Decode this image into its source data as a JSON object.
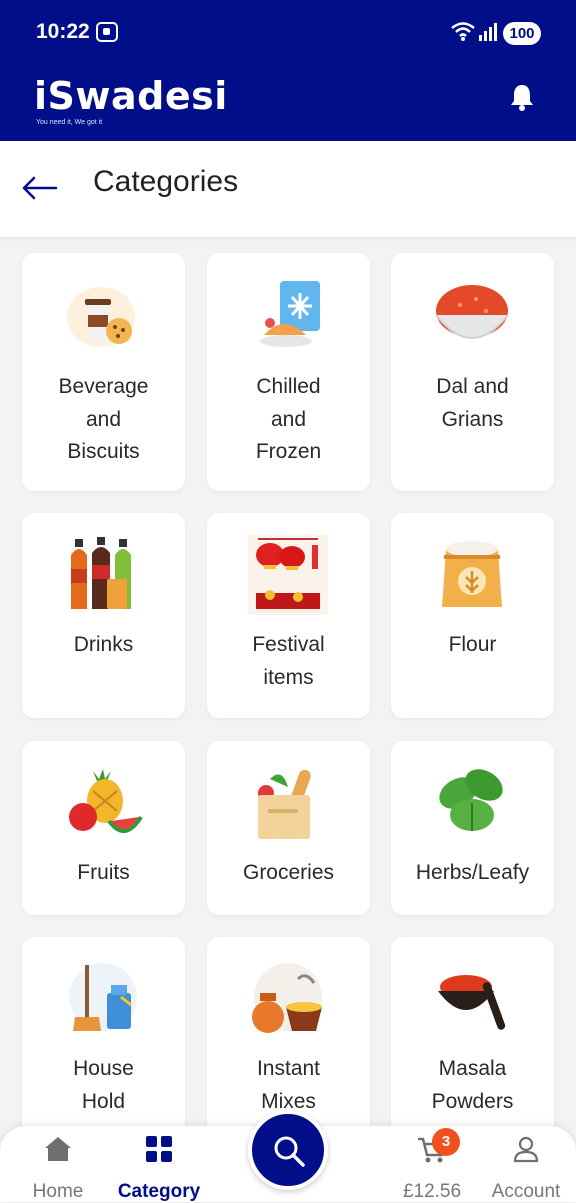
{
  "status": {
    "time": "10:22",
    "battery": "100"
  },
  "header": {
    "logo": "iSwadesi",
    "tagline": "You need it, We got it"
  },
  "page": {
    "title": "Categories"
  },
  "categories": [
    {
      "label_lines": [
        "Beverage",
        "and",
        "Biscuits"
      ],
      "icon": "coffee-cookie-icon"
    },
    {
      "label_lines": [
        "Chilled",
        "and",
        "Frozen"
      ],
      "icon": "frozen-food-icon"
    },
    {
      "label_lines": [
        "Dal and",
        "Grians"
      ],
      "icon": "lentils-bowl-icon"
    },
    {
      "label_lines": [
        "Drinks"
      ],
      "icon": "soda-bottles-icon"
    },
    {
      "label_lines": [
        "Festival",
        "items"
      ],
      "icon": "lanterns-icon"
    },
    {
      "label_lines": [
        "Flour"
      ],
      "icon": "flour-sack-icon"
    },
    {
      "label_lines": [
        "Fruits"
      ],
      "icon": "fruits-icon"
    },
    {
      "label_lines": [
        "Groceries"
      ],
      "icon": "grocery-bag-icon"
    },
    {
      "label_lines": [
        "Herbs/Leafy"
      ],
      "icon": "basil-leaves-icon"
    },
    {
      "label_lines": [
        "House",
        "Hold"
      ],
      "icon": "cleaning-supplies-icon"
    },
    {
      "label_lines": [
        "Instant",
        "Mixes"
      ],
      "icon": "instant-food-icon"
    },
    {
      "label_lines": [
        "Masala",
        "Powders"
      ],
      "icon": "spice-bowl-icon"
    }
  ],
  "nav": {
    "home": "Home",
    "category": "Category",
    "cart_total": "£12.56",
    "cart_count": "3",
    "account": "Account"
  },
  "colors": {
    "brand": "#000e8a",
    "badge": "#f0501e"
  }
}
